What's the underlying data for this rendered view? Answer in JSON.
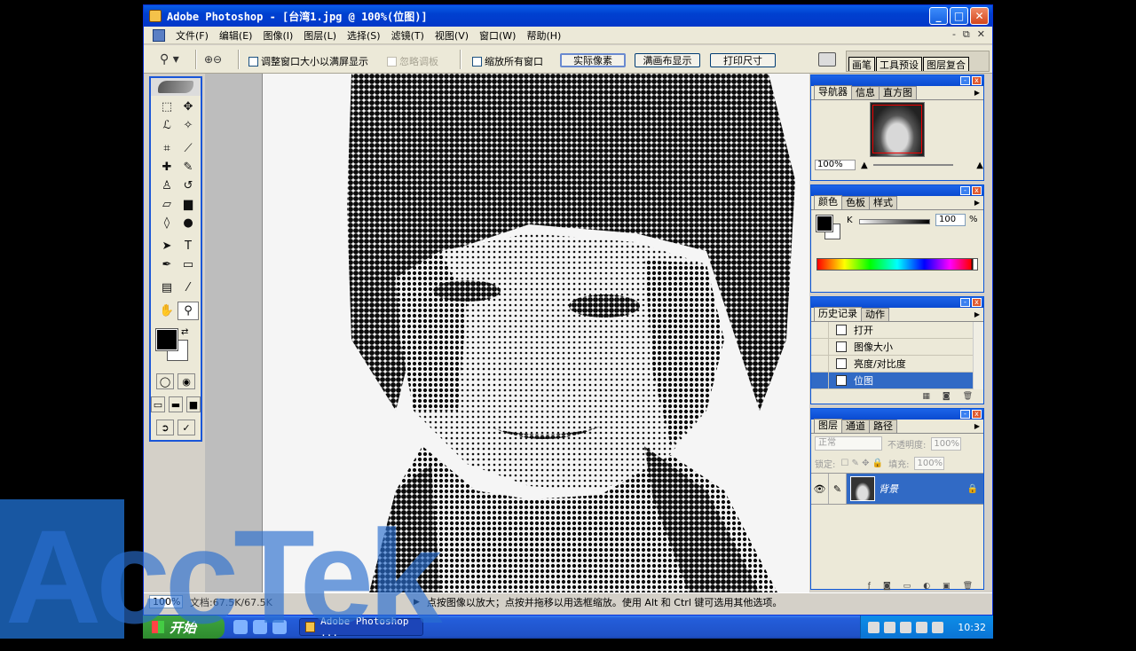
{
  "window": {
    "title": "Adobe Photoshop - [台湾1.jpg @ 100%(位图)]",
    "buttons": {
      "minimize": "_",
      "maximize": "□",
      "close": "✕"
    }
  },
  "menu": {
    "items": [
      "文件(F)",
      "编辑(E)",
      "图像(I)",
      "图层(L)",
      "选择(S)",
      "滤镜(T)",
      "视图(V)",
      "窗口(W)",
      "帮助(H)"
    ],
    "mdi": [
      "-",
      "⧉",
      "✕"
    ]
  },
  "options": {
    "checkbox_resize": "调整窗口大小以满屏显示",
    "checkbox_ignore": "忽略调板",
    "checkbox_zoom_all": "缩放所有窗口",
    "btn_actual": "实际像素",
    "btn_fit": "满画布显示",
    "btn_print": "打印尺寸",
    "well_tabs": [
      "画笔",
      "工具预设",
      "图层复合"
    ]
  },
  "toolbox": {
    "tools": [
      {
        "name": "marquee-tool",
        "glyph": "⬚"
      },
      {
        "name": "move-tool",
        "glyph": "✥"
      },
      {
        "name": "lasso-tool",
        "glyph": "ℒ"
      },
      {
        "name": "magic-wand-tool",
        "glyph": "✧"
      },
      {
        "name": "crop-tool",
        "glyph": "⌗"
      },
      {
        "name": "slice-tool",
        "glyph": "⟋"
      },
      {
        "name": "healing-brush-tool",
        "glyph": "✚"
      },
      {
        "name": "brush-tool",
        "glyph": "✎"
      },
      {
        "name": "clone-stamp-tool",
        "glyph": "♙"
      },
      {
        "name": "history-brush-tool",
        "glyph": "↺"
      },
      {
        "name": "eraser-tool",
        "glyph": "▱"
      },
      {
        "name": "gradient-tool",
        "glyph": "▆"
      },
      {
        "name": "blur-tool",
        "glyph": "◊"
      },
      {
        "name": "dodge-tool",
        "glyph": "●"
      },
      {
        "name": "path-selection-tool",
        "glyph": "➤"
      },
      {
        "name": "type-tool",
        "glyph": "T"
      },
      {
        "name": "pen-tool",
        "glyph": "✒"
      },
      {
        "name": "shape-tool",
        "glyph": "▭"
      },
      {
        "name": "notes-tool",
        "glyph": "▤"
      },
      {
        "name": "eyedropper-tool",
        "glyph": "⁄"
      },
      {
        "name": "hand-tool",
        "glyph": "✋"
      },
      {
        "name": "zoom-tool",
        "glyph": "⚲"
      }
    ]
  },
  "status": {
    "zoom": "100%",
    "doc": "文档:67.5K/67.5K",
    "hint": "点按图像以放大；点按并拖移以用选框缩放。使用 Alt 和 Ctrl 键可选用其他选项。"
  },
  "navigator": {
    "tabs": [
      "导航器",
      "信息",
      "直方图"
    ],
    "zoom": "100%"
  },
  "color": {
    "tabs": [
      "颜色",
      "色板",
      "样式"
    ],
    "channel": "K",
    "value": "100",
    "unit": "%"
  },
  "history": {
    "tabs": [
      "历史记录",
      "动作"
    ],
    "items": [
      "打开",
      "图像大小",
      "亮度/对比度",
      "位图"
    ],
    "selected_index": 3
  },
  "layers": {
    "tabs": [
      "图层",
      "通道",
      "路径"
    ],
    "blend_mode": "正常",
    "opacity_label": "不透明度:",
    "opacity": "100%",
    "lock_label": "锁定:",
    "fill_label": "填充:",
    "fill": "100%",
    "layer_name": "背景"
  },
  "taskbar": {
    "start": "开始",
    "task": "Adobe Photoshop ...",
    "clock": "10:32"
  },
  "watermark": {
    "text": "AccTek"
  }
}
